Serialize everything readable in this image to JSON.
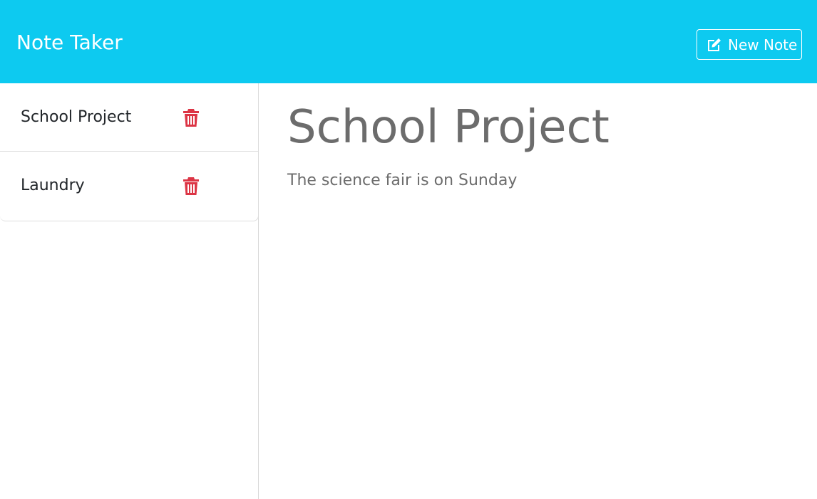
{
  "header": {
    "brand": "Note Taker",
    "new_note_label": "New Note",
    "new_note_icon": "edit-icon",
    "background_color": "#0dcaf0"
  },
  "sidebar": {
    "items": [
      {
        "label": "School Project",
        "icon": "trash-icon"
      },
      {
        "label": "Laundry",
        "icon": "trash-icon"
      }
    ],
    "delete_icon_color": "#dc3545"
  },
  "main": {
    "note_title": "School Project",
    "note_text": "The science fair is on Sunday"
  }
}
